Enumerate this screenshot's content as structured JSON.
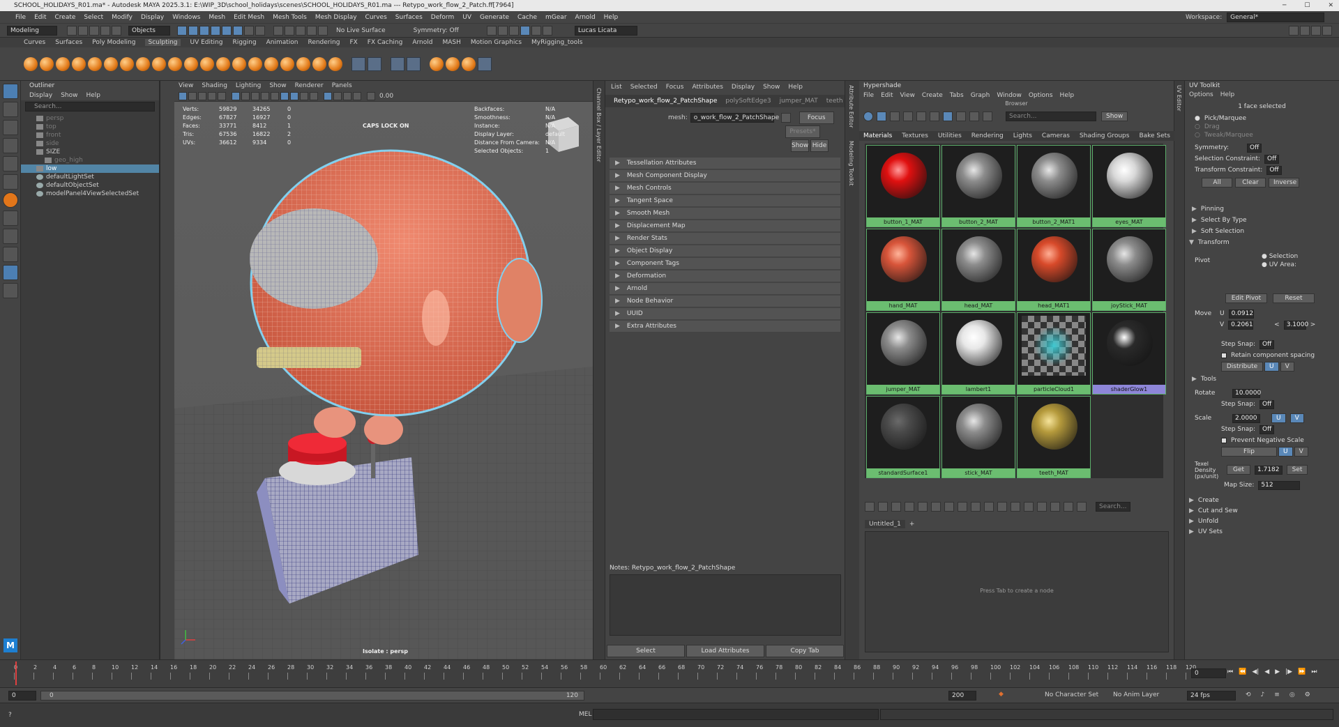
{
  "title": "SCHOOL_HOLIDAYS_R01.ma* - Autodesk MAYA 2025.3.1: E:\\WIP_3D\\school_holidays\\scenes\\SCHOOL_HOLIDAYS_R01.ma  ---  Retypo_work_flow_2_Patch.ff[7964]",
  "menus": [
    "File",
    "Edit",
    "Create",
    "Select",
    "Modify",
    "Display",
    "Windows",
    "Mesh",
    "Edit Mesh",
    "Mesh Tools",
    "Mesh Display",
    "Curves",
    "Surfaces",
    "Deform",
    "UV",
    "Generate",
    "Cache",
    "mGear",
    "Arnold",
    "Help"
  ],
  "workspace": {
    "label": "Workspace:",
    "value": "General*"
  },
  "status": {
    "mode": "Modeling",
    "objects": "Objects",
    "live_surface": "No Live Surface",
    "symmetry": "Symmetry: Off",
    "user": "Lucas Licata"
  },
  "shelf_tabs": [
    "Curves",
    "Surfaces",
    "Poly Modeling",
    "Sculpting",
    "UV Editing",
    "Rigging",
    "Animation",
    "Rendering",
    "FX",
    "FX Caching",
    "Arnold",
    "MASH",
    "Motion Graphics",
    "MyRigging_tools"
  ],
  "shelf_active": "Sculpting",
  "outliner": {
    "title": "Outliner",
    "menu": [
      "Display",
      "Show",
      "Help"
    ],
    "search_placeholder": "Search...",
    "items": [
      {
        "label": "persp",
        "dim": true,
        "indent": 1
      },
      {
        "label": "top",
        "dim": true,
        "indent": 1
      },
      {
        "label": "front",
        "dim": true,
        "indent": 1
      },
      {
        "label": "side",
        "dim": true,
        "indent": 1
      },
      {
        "label": "SIZE",
        "dim": false,
        "indent": 1
      },
      {
        "label": "geo_high",
        "dim": true,
        "indent": 2
      },
      {
        "label": "low",
        "dim": false,
        "indent": 1,
        "selected": true
      },
      {
        "label": "defaultLightSet",
        "dim": false,
        "indent": 1
      },
      {
        "label": "defaultObjectSet",
        "dim": false,
        "indent": 1
      },
      {
        "label": "modelPanel4ViewSelectedSet",
        "dim": false,
        "indent": 1
      }
    ]
  },
  "viewport": {
    "menu": [
      "View",
      "Shading",
      "Lighting",
      "Show",
      "Renderer",
      "Panels"
    ],
    "gamma": "0.00",
    "caps": "CAPS LOCK ON",
    "footer": "Isolate : persp",
    "stats_left": [
      {
        "k": "Verts:",
        "a": "59829",
        "b": "34265",
        "c": "0"
      },
      {
        "k": "Edges:",
        "a": "67827",
        "b": "16927",
        "c": "0"
      },
      {
        "k": "Faces:",
        "a": "33771",
        "b": "8412",
        "c": "1"
      },
      {
        "k": "Tris:",
        "a": "67536",
        "b": "16822",
        "c": "2"
      },
      {
        "k": "UVs:",
        "a": "36612",
        "b": "9334",
        "c": "0"
      }
    ],
    "stats_right": [
      {
        "k": "Backfaces:",
        "v": "N/A"
      },
      {
        "k": "Smoothness:",
        "v": "N/A"
      },
      {
        "k": "Instance:",
        "v": "N/A"
      },
      {
        "k": "Display Layer:",
        "v": "default"
      },
      {
        "k": "Distance From Camera:",
        "v": "N/A"
      },
      {
        "k": "Selected Objects:",
        "v": "1"
      }
    ]
  },
  "channel_box_label": "Channel Box / Layer Editor",
  "attr_editor": {
    "menu": [
      "List",
      "Selected",
      "Focus",
      "Attributes",
      "Display",
      "Show",
      "Help"
    ],
    "tabs": [
      "Retypo_work_flow_2_PatchShape",
      "polySoftEdge3",
      "jumper_MAT",
      "teeth"
    ],
    "mesh_label": "mesh:",
    "mesh_value": "o_work_flow_2_PatchShape",
    "focus": "Focus",
    "presets": "Presets*",
    "show": "Show",
    "hide": "Hide",
    "sections": [
      "Tessellation Attributes",
      "Mesh Component Display",
      "Mesh Controls",
      "Tangent Space",
      "Smooth Mesh",
      "Displacement Map",
      "Render Stats",
      "Object Display",
      "Component Tags",
      "Deformation",
      "Arnold",
      "Node Behavior",
      "UUID",
      "Extra Attributes"
    ],
    "notes": "Notes:  Retypo_work_flow_2_PatchShape",
    "buttons": [
      "Select",
      "Load Attributes",
      "Copy Tab"
    ]
  },
  "side_strips": [
    "Attribute Editor",
    "Modeling Toolkit",
    "UV Editor"
  ],
  "hypershade": {
    "title": "Hypershade",
    "menu": [
      "File",
      "Edit",
      "View",
      "Create",
      "Tabs",
      "Graph",
      "Window",
      "Options",
      "Help"
    ],
    "browser": "Browser",
    "search_placeholder": "Search...",
    "show": "Show",
    "tabs": [
      "Materials",
      "Textures",
      "Utilities",
      "Rendering",
      "Lights",
      "Cameras",
      "Shading Groups",
      "Bake Sets"
    ],
    "swatches": [
      {
        "name": "button_1_MAT",
        "color": "#e01010",
        "spec": "#ff9a9a"
      },
      {
        "name": "button_2_MAT",
        "color": "#8c8c8c",
        "spec": "#e6e6e6"
      },
      {
        "name": "button_2_MAT1",
        "color": "#8c8c8c",
        "spec": "#e6e6e6"
      },
      {
        "name": "eyes_MAT",
        "color": "#d8d8d8",
        "spec": "#ffffff"
      },
      {
        "name": "hand_MAT",
        "color": "#d8553a",
        "spec": "#ffb49a"
      },
      {
        "name": "head_MAT",
        "color": "#8c8c8c",
        "spec": "#e6e6e6"
      },
      {
        "name": "head_MAT1",
        "color": "#d84a2a",
        "spec": "#ffae94"
      },
      {
        "name": "joyStick_MAT",
        "color": "#8c8c8c",
        "spec": "#e6e6e6"
      },
      {
        "name": "jumper_MAT",
        "color": "#8c8c8c",
        "spec": "#e6e6e6"
      },
      {
        "name": "lambert1",
        "color": "#e8e8e8",
        "spec": "#ffffff"
      },
      {
        "name": "particleCloud1",
        "color": "checker",
        "spec": "#3fc8d0"
      },
      {
        "name": "shaderGlow1",
        "color": "#2a2a2a",
        "spec": "#ffffff",
        "selected": true
      },
      {
        "name": "standardSurface1",
        "color": "#4a4a4a",
        "spec": "#6a6a6a"
      },
      {
        "name": "stick_MAT",
        "color": "#8c8c8c",
        "spec": "#e6e6e6"
      },
      {
        "name": "teeth_MAT",
        "color": "#b59a3c",
        "spec": "#f5e39a"
      }
    ],
    "graph_tab": "Untitled_1",
    "graph_hint": "Press Tab to create a node",
    "graph_search": "Search..."
  },
  "uv_toolkit": {
    "title": "UV Toolkit",
    "menu": [
      "Options",
      "Help"
    ],
    "face_info": "1 face selected",
    "modes": [
      "Pick/Marquee",
      "Drag",
      "Tweak/Marquee"
    ],
    "symmetry": {
      "label": "Symmetry:",
      "value": "Off"
    },
    "sel_constraint": {
      "label": "Selection Constraint:",
      "value": "Off"
    },
    "xform_constraint": {
      "label": "Transform Constraint:",
      "value": "Off"
    },
    "sel_buttons": [
      "All",
      "Clear",
      "Inverse"
    ],
    "collapsibles": [
      "Pinning",
      "Select By Type",
      "Soft Selection"
    ],
    "transform": "Transform",
    "pivot": "Pivot",
    "pivot_opts": [
      "Selection",
      "UV Area:"
    ],
    "edit_pivot": "Edit Pivot",
    "reset": "Reset",
    "move": {
      "label": "Move",
      "u": "0.0912",
      "v": "0.2061",
      "step": "3.1000"
    },
    "step_snap": "Step Snap:",
    "off": "Off",
    "retain": "Retain component spacing",
    "distribute": "Distribute",
    "u": "U",
    "v": "V",
    "tools": "Tools",
    "rotate": {
      "label": "Rotate",
      "value": "10.0000"
    },
    "scale": {
      "label": "Scale",
      "value": "2.0000"
    },
    "prevent_neg": "Prevent Negative Scale",
    "flip": "Flip",
    "texel": {
      "label": "Texel Density (px/unit)",
      "get": "Get",
      "value": "1.7182",
      "set": "Set"
    },
    "map_size": {
      "label": "Map Size:",
      "value": "512"
    },
    "bottom": [
      "Create",
      "Cut and Sew",
      "Unfold",
      "UV Sets"
    ]
  },
  "timeline": {
    "ticks": [
      "0",
      "2",
      "4",
      "6",
      "8",
      "10",
      "12",
      "14",
      "16",
      "18",
      "20",
      "22",
      "24",
      "26",
      "28",
      "30",
      "32",
      "34",
      "36",
      "38",
      "40",
      "42",
      "44",
      "46",
      "48",
      "50",
      "52",
      "54",
      "56",
      "58",
      "60",
      "62",
      "64",
      "66",
      "68",
      "70",
      "72",
      "74",
      "76",
      "78",
      "80",
      "82",
      "84",
      "86",
      "88",
      "90",
      "92",
      "94",
      "96",
      "98",
      "100",
      "102",
      "104",
      "106",
      "108",
      "110",
      "112",
      "114",
      "116",
      "118",
      "120"
    ],
    "current": "0",
    "start": "0",
    "start2": "0",
    "range_end": "120",
    "end": "200",
    "character": "No Character Set",
    "anim_layer": "No Anim Layer",
    "fps": "24 fps"
  },
  "cmd_label": "MEL"
}
